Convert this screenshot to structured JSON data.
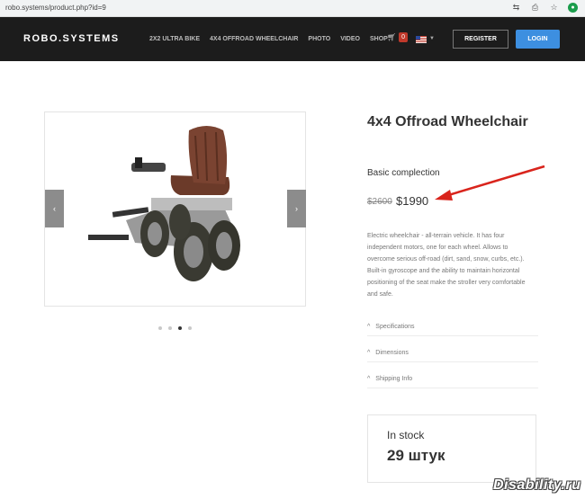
{
  "browser": {
    "url": "robo.systems/product.php?id=9",
    "icons": [
      "translate-icon",
      "share-icon",
      "star-icon",
      "extension-icon"
    ]
  },
  "navbar": {
    "logo": "ROBO.SYSTEMS",
    "links": [
      "2X2 ULTRA BIKE",
      "4X4 OFFROAD WHEELCHAIR",
      "PHOTO",
      "VIDEO",
      "SHOP"
    ],
    "cart_count": "0",
    "register_label": "REGISTER",
    "login_label": "LOGIN"
  },
  "gallery": {
    "prev_icon": "‹",
    "next_icon": "›",
    "slide_count": 4,
    "active_slide": 3
  },
  "product": {
    "title": "4x4 Offroad Wheelchair",
    "subtitle": "Basic complection",
    "old_price": "$2600",
    "new_price": "$1990",
    "description": "Electric wheelchair - all-terrain vehicle. It has four independent motors, one for each wheel. Allows to overcome serious off-road (dirt, sand, snow, curbs, etc.). Built-in gyroscope and the ability to maintain horizontal positioning of the seat make the stroller very comfortable and safe.",
    "accordion": [
      "Specifications",
      "Dimensions",
      "Shipping Info"
    ]
  },
  "stock": {
    "label": "In stock",
    "count": "29 штук"
  },
  "watermark": "Disability.ru",
  "colors": {
    "nav_bg": "#1c1c1c",
    "login_bg": "#3d8fe0",
    "badge": "#c0392b",
    "annotation_arrow": "#d9241c"
  }
}
